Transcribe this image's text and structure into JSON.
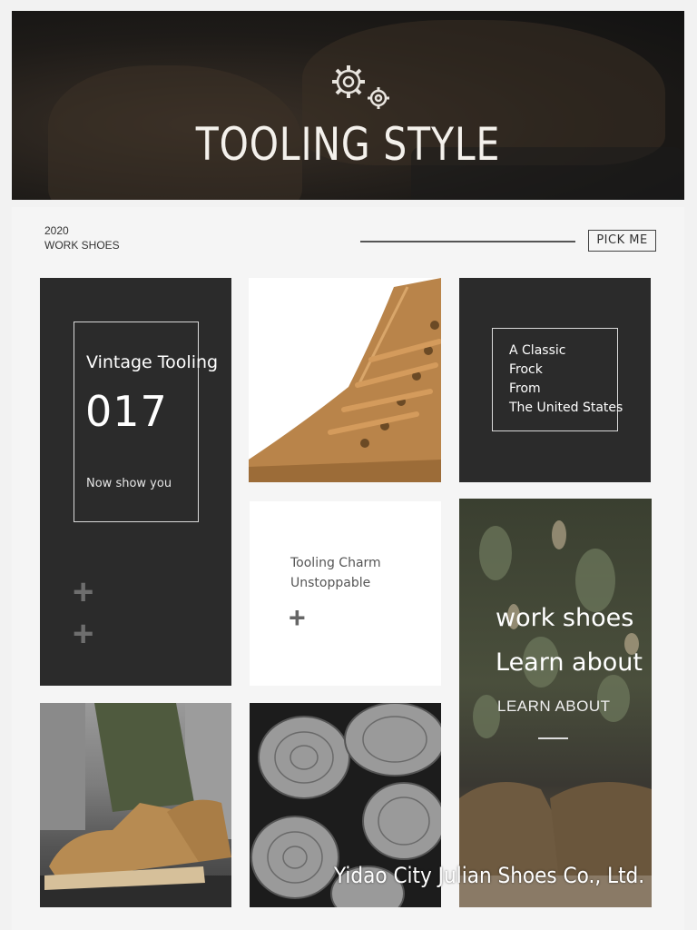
{
  "banner": {
    "title": "TOOLING STYLE",
    "icon": "gears-icon"
  },
  "header": {
    "year": "2020",
    "subtitle": "WORK SHOES",
    "pick_label": "PICK ME"
  },
  "vintage": {
    "title": "Vintage Tooling",
    "number": "017",
    "note": "Now show you",
    "plus": "+"
  },
  "classic": {
    "lines": [
      "A Classic",
      "Frock",
      "From",
      "The United States"
    ]
  },
  "charm": {
    "lines": [
      "Tooling Charm",
      "Unstoppable"
    ],
    "plus": "+"
  },
  "work": {
    "line1": "work shoes",
    "line2": "Learn about",
    "line3": "LEARN ABOUT"
  },
  "watermark": "Yidao City Julian Shoes Co., Ltd.",
  "colors": {
    "dark_tile": "#2b2b2b",
    "boot_tan": "#b9844a",
    "background": "#f2f2f2"
  }
}
